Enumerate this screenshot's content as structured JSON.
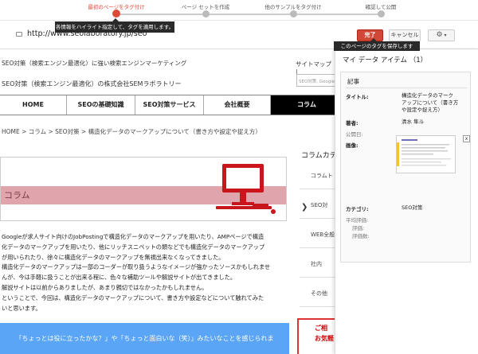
{
  "stepper": {
    "steps": [
      "最初のページをタグ付け",
      "ページ セットを作成",
      "他のサンプルをタグ付け",
      "確認して公開"
    ],
    "tooltip": "各情報をハイライト指定して、タグを適用します。"
  },
  "toolbar": {
    "url": "http://www.seolaboratory.jp/seo/...",
    "done_label": "完了",
    "cancel_label": "キャンセル",
    "settings_icon": "gear-icon",
    "save_tooltip": "このページのタグを保存します"
  },
  "site": {
    "tagline": "SEO対策（検索エンジン最適化）に強い検索エンジンマーケティング",
    "company": "SEO対策（検索エンジン最適化）の株式会社SEMラボラトリー",
    "sitemap": "サイトマップ |",
    "search_placeholder": "SEO対策, Google",
    "nav": [
      "HOME",
      "SEOの基礎知識",
      "SEO対策サービス",
      "会社概要",
      "コラム"
    ],
    "breadcrumb": "HOME > コラム > SEO対策 > 構造化データのマークアップについて（書き方や設定や捉え方）",
    "banner_label": "コラム",
    "article_lines": [
      "Googleが求人サイト向けのJobPostingで構造化データのマークアップを用いたり、AMPページで構造",
      "化データのマークアップを用いたり、他にリッチスニペットの類などでも構造化データのマークアップ",
      "が用いられたり、徐々に構造化データのマークアップを無視出来なくなってきました。",
      "構造化データのマークアップは一部のコーダーが取り扱うようなイメージが強かったソースかもしれませ",
      "んが、今は手軽に扱うことが出来る程に、色々な補助ツールや解説サイトが出てきました。",
      "解説サイトは以前からありましたが、あまり親切ではなかったかもしれません。",
      "ということで、今回は、構造化データのマークアップについて、書き方や設定などについて触れてみた",
      "いと思います。"
    ],
    "highlight_text": "「ちょっとは役に立ったかな？」や「ちょっと面白いな（笑）」みたいなことを感じられま",
    "sidebar_title": "コラムカテ",
    "sidebar_items": [
      "コラムト",
      "SEO対",
      "WEB全般",
      "社内",
      "その他"
    ],
    "contact_line1": "ご相",
    "contact_line2": "お気軽"
  },
  "panel": {
    "title": "マイ データ アイテム （1）",
    "card_header": "記事",
    "fields": [
      {
        "label": "タイトル:",
        "value": [
          "構造化データのマーク",
          "アップについて（書き方",
          "や設定や捉え方）"
        ]
      },
      {
        "label": "著者:",
        "value": [
          "清水 隼斗"
        ]
      },
      {
        "label": "公開日:",
        "value": []
      },
      {
        "label": "画像:",
        "value": []
      },
      {
        "label": "カテゴリ:",
        "value": [
          "SEO対策"
        ]
      },
      {
        "label": "平均評価:",
        "value": []
      },
      {
        "label": "評価:",
        "value": []
      },
      {
        "label": "評価数:",
        "value": []
      }
    ],
    "remove_label": "x"
  },
  "colors": {
    "accent_red": "#dd4b39",
    "nav_active": "#000000",
    "banner_pink": "#e0a4ac",
    "highlight_blue": "#5aa5f5"
  }
}
